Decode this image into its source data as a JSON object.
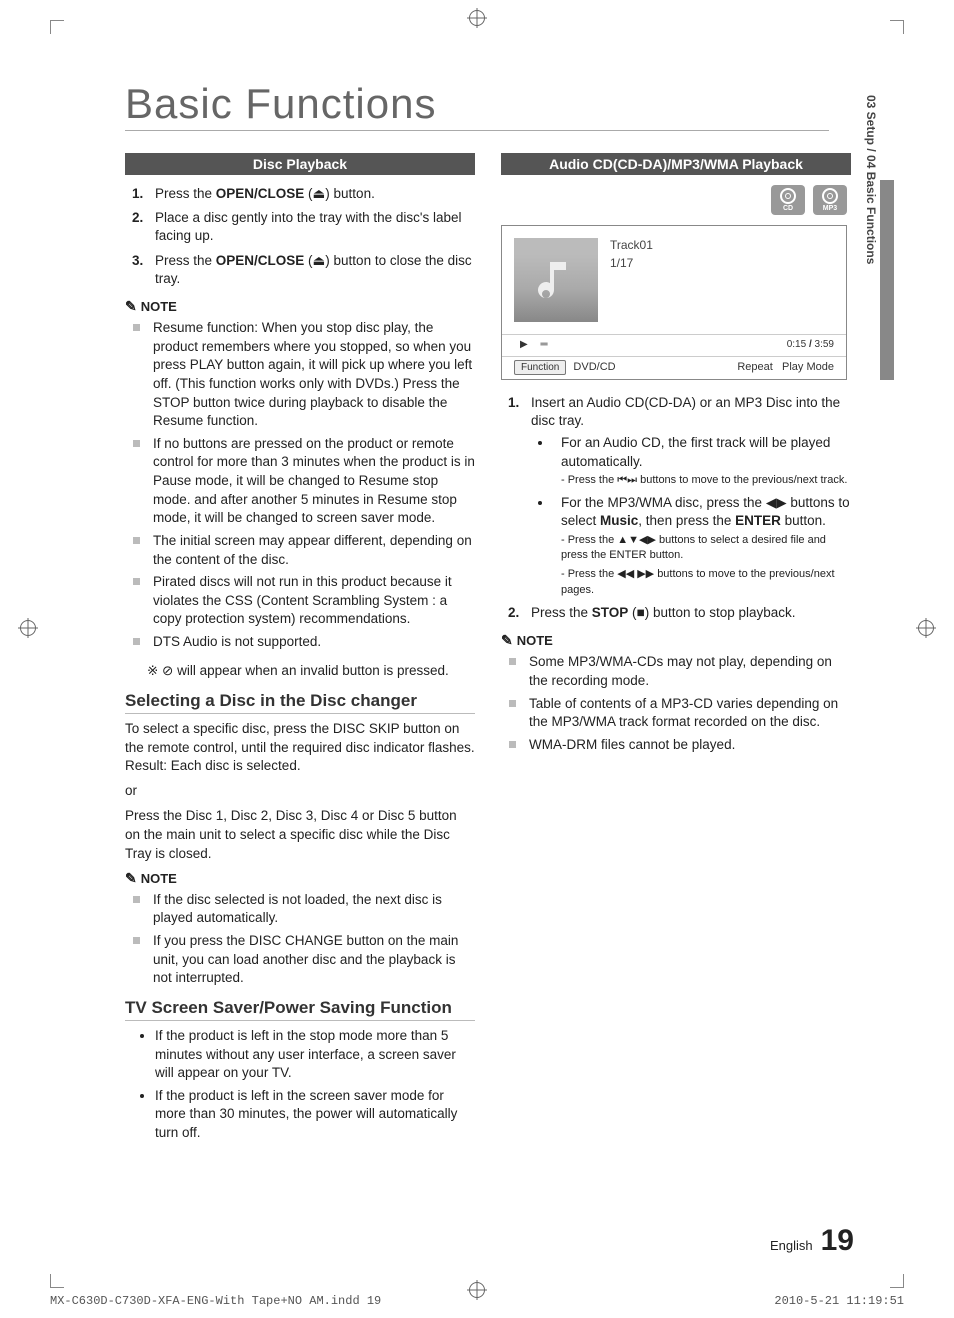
{
  "page": {
    "title": "Basic Functions",
    "side_label": "03   Setup   /   04   Basic Functions",
    "footer_lang": "English",
    "footer_page": "19",
    "print_footer_left": "MX-C630D-C730D-XFA-ENG-With Tape+NO AM.indd   19",
    "print_footer_right": "2010-5-21   11:19:51"
  },
  "left": {
    "section1_hdr": "Disc Playback",
    "steps1": [
      {
        "pre": "Press the ",
        "bold": "OPEN/CLOSE",
        "post": " (⏏) button."
      },
      {
        "pre": "Place a disc gently into the tray with the disc's label facing up.",
        "bold": "",
        "post": ""
      },
      {
        "pre": "Press the ",
        "bold": "OPEN/CLOSE",
        "post": " (⏏) button to close the disc tray."
      }
    ],
    "note_label": "NOTE",
    "notes1": [
      "Resume function: When you stop disc play, the product remembers where you stopped, so when you press PLAY button again, it will pick up where you left off. (This function works only with DVDs.) Press the STOP button twice during playback to disable the Resume function.",
      "If no buttons are pressed on the product or remote control for more than 3 minutes when the product is in Pause mode, it will be changed to Resume stop mode. and after another 5 minutes in Resume stop mode, it will be changed to screen saver mode.",
      "The initial screen may appear different, depending on the content of the disc.",
      "Pirated discs will not run in this product because it violates the CSS (Content Scrambling System : a copy protection system) recommendations.",
      "DTS Audio is not supported."
    ],
    "invalid_note": "※  ⊘ will appear when an invalid button is pressed.",
    "subhead1": "Selecting a Disc in the Disc changer",
    "subhead1_body1": "To select a specific disc, press the DISC SKIP button on the remote control, until the required disc indicator flashes. Result: Each disc is selected.",
    "subhead1_body_or": "or",
    "subhead1_body2": "Press the Disc 1, Disc 2, Disc 3, Disc 4 or Disc 5 button on the main unit to select a specific disc while the Disc Tray is closed.",
    "notes2": [
      "If the disc selected is not loaded, the next disc is played automatically.",
      "If you press the DISC CHANGE button on the main unit, you can load another disc and the playback is not interrupted."
    ],
    "subhead2": "TV Screen Saver/Power Saving Function",
    "tv_bullets": [
      "If the product is left in the stop mode more than 5 minutes without any user interface, a screen saver will appear on your TV.",
      "If the product is left in the screen saver mode for more than 30 minutes, the power will automatically turn off."
    ]
  },
  "right": {
    "section2_hdr": "Audio CD(CD-DA)/MP3/WMA Playback",
    "disc_badges": [
      "CD",
      "MP3"
    ],
    "player": {
      "track": "Track01",
      "counter": "1/17",
      "time_elapsed": "0:15",
      "time_total": "3:59",
      "fn_button": "Function",
      "fn_label": "DVD/CD",
      "repeat": "Repeat",
      "playmode": "Play Mode"
    },
    "steps2": [
      {
        "text": "Insert an Audio CD(CD-DA) or an MP3 Disc into the disc tray.",
        "subs": [
          {
            "main": "For an Audio CD, the first track will be played automatically.",
            "lines": [
              "- Press the ⏮⏭ buttons to move to the previous/next track."
            ]
          },
          {
            "main_pre": "For the MP3/WMA disc, press the ◀▶ buttons to select ",
            "main_bold": "Music",
            "main_post": ", then press the ",
            "main_bold2": "ENTER",
            "main_post2": " button.",
            "lines": [
              "- Press the ▲▼◀▶ buttons to select  a desired file and press the ENTER button.",
              "- Press the  ◀◀ ▶▶  buttons to move to the previous/next pages."
            ]
          }
        ]
      },
      {
        "text_pre": "Press the ",
        "text_bold": "STOP",
        "text_post": " (■) button to stop playback."
      }
    ],
    "notes3": [
      "Some MP3/WMA-CDs may not play, depending on the recording mode.",
      "Table of contents of a MP3-CD varies depending on the MP3/WMA track format recorded on the disc.",
      "WMA-DRM files cannot be played."
    ]
  }
}
